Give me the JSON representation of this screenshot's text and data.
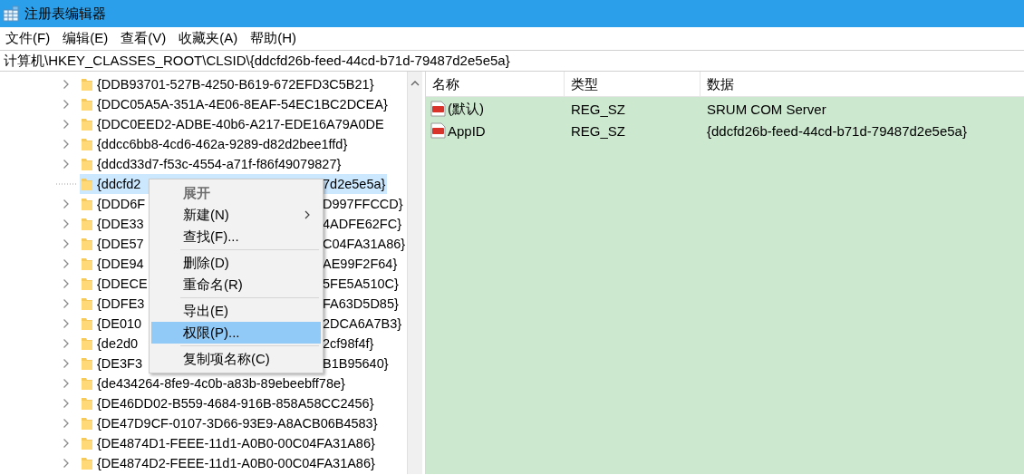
{
  "window": {
    "title": "注册表编辑器"
  },
  "menu": [
    "文件(F)",
    "编辑(E)",
    "查看(V)",
    "收藏夹(A)",
    "帮助(H)"
  ],
  "address": {
    "value": "计算机\\HKEY_CLASSES_ROOT\\CLSID\\{ddcfd26b-feed-44cd-b71d-79487d2e5e5a}"
  },
  "tree": [
    {
      "label": "{DDB93701-527B-4250-B619-672EFD3C5B21}",
      "expandable": true,
      "selected": false
    },
    {
      "label": "{DDC05A5A-351A-4E06-8EAF-54EC1BC2DCEA}",
      "expandable": true,
      "selected": false
    },
    {
      "label": "{DDC0EED2-ADBE-40b6-A217-EDE16A79A0DE",
      "expandable": true,
      "selected": false
    },
    {
      "label": "{ddcc6bb8-4cd6-462a-9289-d82d2bee1ffd}",
      "expandable": true,
      "selected": false
    },
    {
      "label": "{ddcd33d7-f53c-4554-a71f-f86f49079827}",
      "expandable": true,
      "selected": false
    },
    {
      "label": "{ddcfd2",
      "tail": "7d2e5e5a}",
      "expandable": false,
      "selected": true
    },
    {
      "label": "{DDD6F",
      "tail": "D997FFCCD}",
      "expandable": true,
      "selected": false
    },
    {
      "label": "{DDE33",
      "tail": "4ADFE62FC}",
      "expandable": true,
      "selected": false
    },
    {
      "label": "{DDE57",
      "tail": "C04FA31A86}",
      "expandable": true,
      "selected": false
    },
    {
      "label": "{DDE94",
      "tail": "AE99F2F64}",
      "expandable": true,
      "selected": false
    },
    {
      "label": "{DDECE",
      "tail": "5FE5A510C}",
      "expandable": true,
      "selected": false
    },
    {
      "label": "{DDFE3",
      "tail": "FA63D5D85}",
      "expandable": true,
      "selected": false
    },
    {
      "label": "{DE010",
      "tail": "2DCA6A7B3}",
      "expandable": true,
      "selected": false
    },
    {
      "label": "{de2d0",
      "tail": "2cf98f4f}",
      "expandable": true,
      "selected": false
    },
    {
      "label": "{DE3F3",
      "tail": "B1B95640}",
      "expandable": true,
      "selected": false
    },
    {
      "label": "{de434264-8fe9-4c0b-a83b-89ebeebff78e}",
      "expandable": true,
      "selected": false
    },
    {
      "label": "{DE46DD02-B559-4684-916B-858A58CC2456}",
      "expandable": true,
      "selected": false
    },
    {
      "label": "{DE47D9CF-0107-3D66-93E9-A8ACB06B4583}",
      "expandable": true,
      "selected": false
    },
    {
      "label": "{DE4874D1-FEEE-11d1-A0B0-00C04FA31A86}",
      "expandable": true,
      "selected": false
    },
    {
      "label": "{DE4874D2-FEEE-11d1-A0B0-00C04FA31A86}",
      "expandable": true,
      "selected": false
    }
  ],
  "values": {
    "columns": [
      "名称",
      "类型",
      "数据"
    ],
    "rows": [
      {
        "name": "(默认)",
        "type": "REG_SZ",
        "data": "SRUM COM Server"
      },
      {
        "name": "AppID",
        "type": "REG_SZ",
        "data": "{ddcfd26b-feed-44cd-b71d-79487d2e5e5a}"
      }
    ]
  },
  "context_menu": {
    "items": [
      {
        "kind": "item",
        "label": "展开",
        "bold": true,
        "submenu": false,
        "selected": false
      },
      {
        "kind": "item",
        "label": "新建(N)",
        "bold": false,
        "submenu": true,
        "selected": false
      },
      {
        "kind": "item",
        "label": "查找(F)...",
        "bold": false,
        "submenu": false,
        "selected": false
      },
      {
        "kind": "separator"
      },
      {
        "kind": "item",
        "label": "删除(D)",
        "bold": false,
        "submenu": false,
        "selected": false
      },
      {
        "kind": "item",
        "label": "重命名(R)",
        "bold": false,
        "submenu": false,
        "selected": false
      },
      {
        "kind": "separator"
      },
      {
        "kind": "item",
        "label": "导出(E)",
        "bold": false,
        "submenu": false,
        "selected": false
      },
      {
        "kind": "item",
        "label": "权限(P)...",
        "bold": false,
        "submenu": false,
        "selected": true
      },
      {
        "kind": "separator"
      },
      {
        "kind": "item",
        "label": "复制项名称(C)",
        "bold": false,
        "submenu": false,
        "selected": false
      }
    ]
  }
}
